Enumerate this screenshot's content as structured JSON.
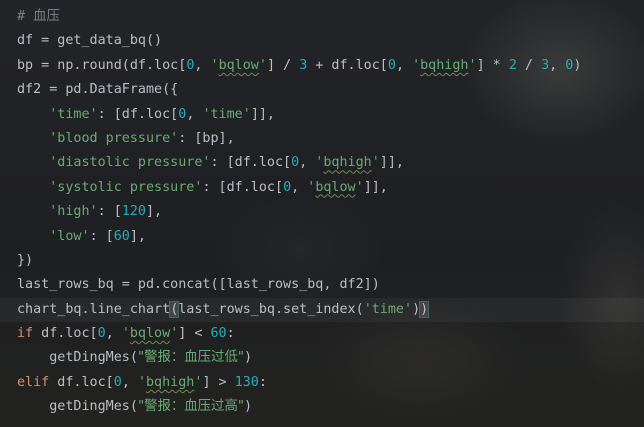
{
  "colors": {
    "background": "#1e1f22",
    "text": "#bcbec4",
    "keyword": "#cf8e6d",
    "string": "#6aab73",
    "number": "#2aacb8",
    "comment": "#7a7e85"
  },
  "code": {
    "lines": [
      [
        {
          "t": "# 血压",
          "c": "comment"
        }
      ],
      [
        {
          "t": "df = get_data_bq()",
          "c": "plain"
        }
      ],
      [
        {
          "t": "bp = np.round(df.loc[",
          "c": "plain"
        },
        {
          "t": "0",
          "c": "num"
        },
        {
          "t": ", ",
          "c": "plain"
        },
        {
          "t": "'",
          "c": "str"
        },
        {
          "t": "bqlow",
          "c": "str squig"
        },
        {
          "t": "'",
          "c": "str"
        },
        {
          "t": "] / ",
          "c": "plain"
        },
        {
          "t": "3",
          "c": "num"
        },
        {
          "t": " + df.loc[",
          "c": "plain"
        },
        {
          "t": "0",
          "c": "num"
        },
        {
          "t": ", ",
          "c": "plain"
        },
        {
          "t": "'",
          "c": "str"
        },
        {
          "t": "bqhigh",
          "c": "str squig"
        },
        {
          "t": "'",
          "c": "str"
        },
        {
          "t": "] * ",
          "c": "plain"
        },
        {
          "t": "2",
          "c": "num"
        },
        {
          "t": " / ",
          "c": "plain"
        },
        {
          "t": "3",
          "c": "num"
        },
        {
          "t": ", ",
          "c": "plain"
        },
        {
          "t": "0",
          "c": "num"
        },
        {
          "t": ")",
          "c": "plain"
        }
      ],
      [
        {
          "t": "df2 = pd.DataFrame({",
          "c": "plain"
        }
      ],
      [
        {
          "t": "    'time'",
          "c": "str"
        },
        {
          "t": ": [df.loc[",
          "c": "plain"
        },
        {
          "t": "0",
          "c": "num"
        },
        {
          "t": ", ",
          "c": "plain"
        },
        {
          "t": "'time'",
          "c": "str"
        },
        {
          "t": "]],",
          "c": "plain"
        }
      ],
      [
        {
          "t": "    'blood pressure'",
          "c": "str"
        },
        {
          "t": ": [bp],",
          "c": "plain"
        }
      ],
      [
        {
          "t": "    'diastolic pressure'",
          "c": "str"
        },
        {
          "t": ": [df.loc[",
          "c": "plain"
        },
        {
          "t": "0",
          "c": "num"
        },
        {
          "t": ", ",
          "c": "plain"
        },
        {
          "t": "'",
          "c": "str"
        },
        {
          "t": "bqhigh",
          "c": "str squig"
        },
        {
          "t": "'",
          "c": "str"
        },
        {
          "t": "]],",
          "c": "plain"
        }
      ],
      [
        {
          "t": "    'systolic pressure'",
          "c": "str"
        },
        {
          "t": ": [df.loc[",
          "c": "plain"
        },
        {
          "t": "0",
          "c": "num"
        },
        {
          "t": ", ",
          "c": "plain"
        },
        {
          "t": "'",
          "c": "str"
        },
        {
          "t": "bqlow",
          "c": "str squig"
        },
        {
          "t": "'",
          "c": "str"
        },
        {
          "t": "]],",
          "c": "plain"
        }
      ],
      [
        {
          "t": "    'high'",
          "c": "str"
        },
        {
          "t": ": [",
          "c": "plain"
        },
        {
          "t": "120",
          "c": "num"
        },
        {
          "t": "],",
          "c": "plain"
        }
      ],
      [
        {
          "t": "    'low'",
          "c": "str"
        },
        {
          "t": ": [",
          "c": "plain"
        },
        {
          "t": "60",
          "c": "num"
        },
        {
          "t": "],",
          "c": "plain"
        }
      ],
      [
        {
          "t": "})",
          "c": "plain"
        }
      ],
      [
        {
          "t": "last_rows_bq = pd.concat([last_rows_bq, df2])",
          "c": "plain"
        }
      ],
      [
        {
          "t": "chart_bq.line_chart",
          "c": "plain"
        },
        {
          "t": "(",
          "c": "paren-match"
        },
        {
          "t": "last_rows_bq.set_index(",
          "c": "plain"
        },
        {
          "t": "'time'",
          "c": "str"
        },
        {
          "t": ")",
          "c": "plain"
        },
        {
          "t": ")",
          "c": "paren-match"
        }
      ],
      [
        {
          "t": "if",
          "c": "kw"
        },
        {
          "t": " df.loc[",
          "c": "plain"
        },
        {
          "t": "0",
          "c": "num"
        },
        {
          "t": ", ",
          "c": "plain"
        },
        {
          "t": "'",
          "c": "str"
        },
        {
          "t": "bqlow",
          "c": "str squig"
        },
        {
          "t": "'",
          "c": "str"
        },
        {
          "t": "] < ",
          "c": "plain"
        },
        {
          "t": "60",
          "c": "num"
        },
        {
          "t": ":",
          "c": "plain"
        }
      ],
      [
        {
          "t": "    getDingMes(",
          "c": "plain"
        },
        {
          "t": "\"警报：血压过低\"",
          "c": "str cjk"
        },
        {
          "t": ")",
          "c": "plain"
        }
      ],
      [
        {
          "t": "elif",
          "c": "kw"
        },
        {
          "t": " df.loc[",
          "c": "plain"
        },
        {
          "t": "0",
          "c": "num"
        },
        {
          "t": ", ",
          "c": "plain"
        },
        {
          "t": "'",
          "c": "str"
        },
        {
          "t": "bqhigh",
          "c": "str squig"
        },
        {
          "t": "'",
          "c": "str"
        },
        {
          "t": "] > ",
          "c": "plain"
        },
        {
          "t": "130",
          "c": "num"
        },
        {
          "t": ":",
          "c": "plain"
        }
      ],
      [
        {
          "t": "    getDingMes(",
          "c": "plain"
        },
        {
          "t": "\"警报：血压过高\"",
          "c": "str cjk"
        },
        {
          "t": ")",
          "c": "plain"
        }
      ]
    ],
    "current_line": 12
  }
}
